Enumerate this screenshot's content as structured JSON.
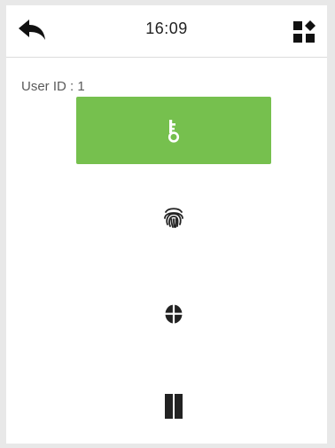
{
  "header": {
    "time": "16:09",
    "back_icon": "back-arrow-icon",
    "menu_icon": "shortcut-grid-icon"
  },
  "user": {
    "id_label": "User ID : 1"
  },
  "verify_options": [
    {
      "icon": "key-icon",
      "selected": true
    },
    {
      "icon": "fingerprint-icon",
      "selected": false
    },
    {
      "icon": "face-icon",
      "selected": false
    },
    {
      "icon": "card-icon",
      "selected": false
    }
  ],
  "colors": {
    "accent": "#76c04e",
    "icon": "#222222",
    "icon_on_accent": "#ffffff"
  }
}
